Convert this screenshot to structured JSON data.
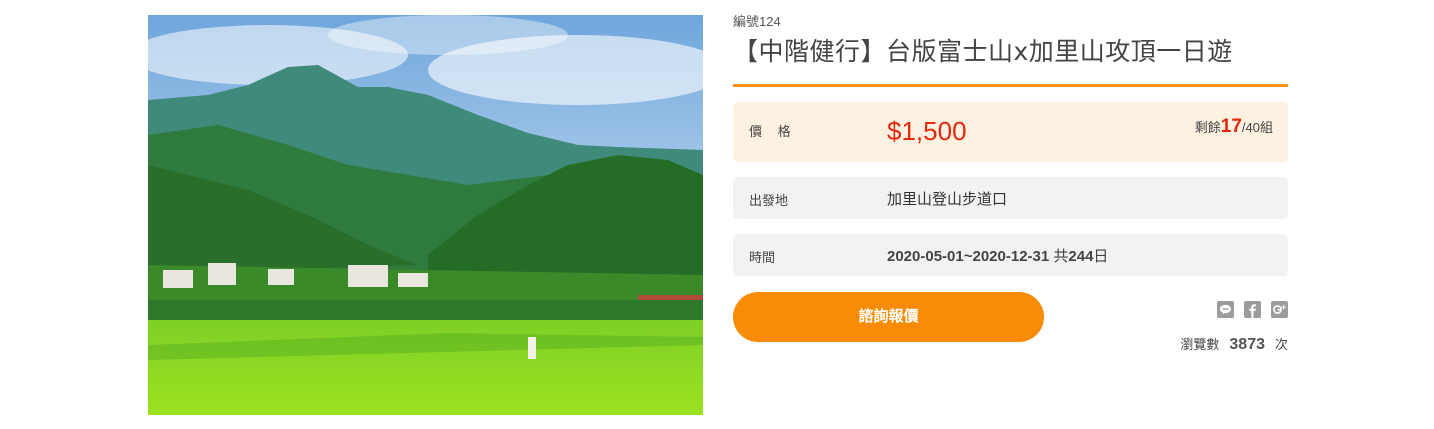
{
  "tour": {
    "code": "編號124",
    "title": "【中階健行】台版富士山x加里山攻頂一日遊",
    "image_alt": "mountain-rice-field-photo"
  },
  "price": {
    "label": "價 格",
    "value": "$1,500",
    "remain_prefix": "剩餘",
    "remain_count": "17",
    "remain_suffix": "/40組"
  },
  "departure": {
    "label": "出發地",
    "value": "加里山登山步道口"
  },
  "period": {
    "label": "時間",
    "dates": "2020-05-01~2020-12-31",
    "total_prefix": " 共",
    "days": "244",
    "days_suffix": "日"
  },
  "actions": {
    "inquiry_label": "諮詢報價"
  },
  "share": [
    "line-icon",
    "facebook-icon",
    "google-plus-icon"
  ],
  "stats": {
    "views_label": "瀏覽數",
    "views_count": "3873",
    "views_unit": "次"
  },
  "colors": {
    "accent": "#f7941d",
    "button": "#f98b06",
    "price": "#e8260c",
    "price_row_bg": "#fdf2e1",
    "row_bg": "#f2f2f2"
  }
}
